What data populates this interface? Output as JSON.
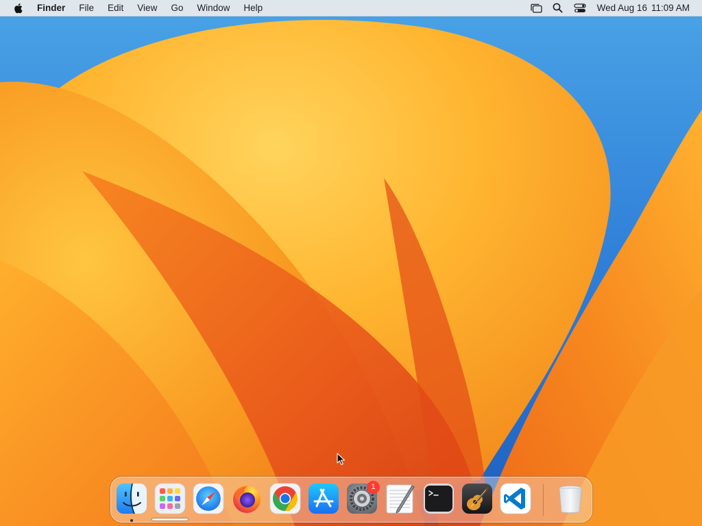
{
  "menubar": {
    "apple_icon": "apple-logo-icon",
    "app_name": "Finder",
    "menus": [
      "File",
      "Edit",
      "View",
      "Go",
      "Window",
      "Help"
    ],
    "status_icons": [
      "stage-manager-icon",
      "spotlight-search-icon",
      "control-center-icon"
    ],
    "clock": {
      "date": "Wed Aug 16",
      "time": "11:09 AM"
    }
  },
  "dock": {
    "apps": [
      {
        "name": "Finder",
        "icon": "finder-icon",
        "running": true
      },
      {
        "name": "Launchpad",
        "icon": "launchpad-icon"
      },
      {
        "name": "Safari",
        "icon": "safari-icon"
      },
      {
        "name": "Firefox",
        "icon": "firefox-icon"
      },
      {
        "name": "Google Chrome",
        "icon": "chrome-icon"
      },
      {
        "name": "App Store",
        "icon": "app-store-icon"
      },
      {
        "name": "System Settings",
        "icon": "system-settings-icon",
        "badge": "1"
      },
      {
        "name": "TextEdit",
        "icon": "textedit-icon"
      },
      {
        "name": "Terminal",
        "icon": "terminal-icon"
      },
      {
        "name": "GarageBand",
        "icon": "garageband-icon"
      },
      {
        "name": "Visual Studio Code",
        "icon": "vscode-icon"
      },
      {
        "name": "Trash",
        "icon": "trash-icon"
      }
    ]
  },
  "colors": {
    "wallpaper_sky": "#2f79d6",
    "wallpaper_orange": "#f59a1e",
    "wallpaper_deep": "#e8561a",
    "badge": "#ff3b30"
  }
}
